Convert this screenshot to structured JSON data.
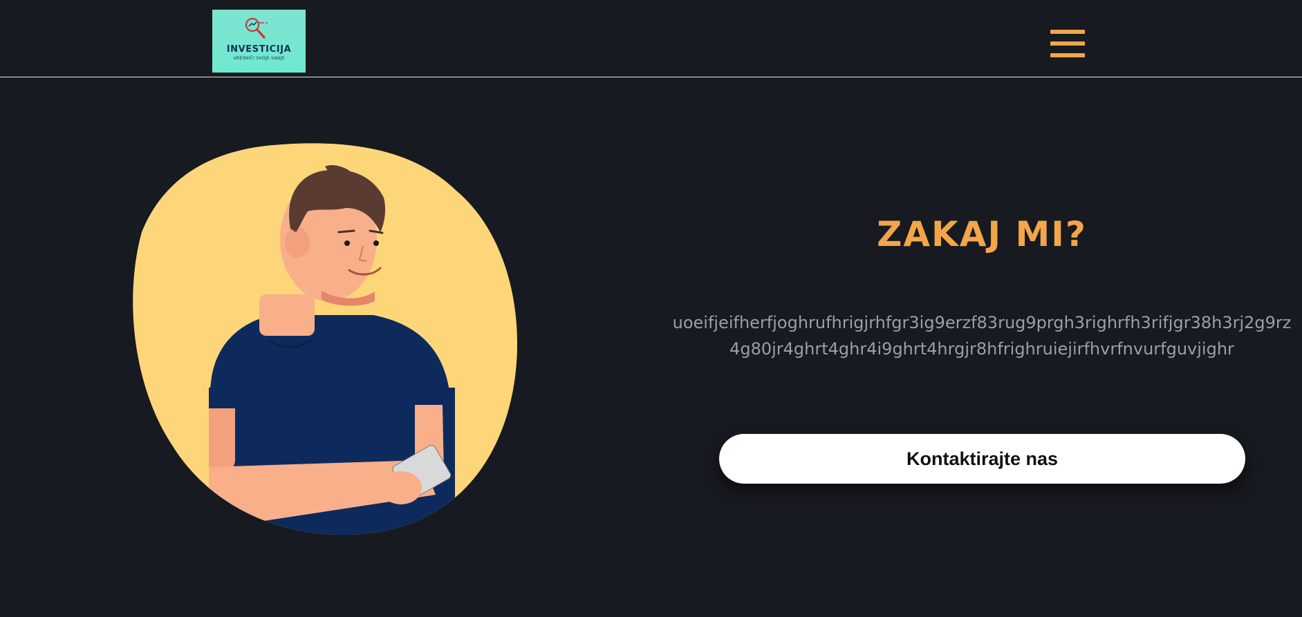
{
  "header": {
    "logo": {
      "title": "INVESTICIJA",
      "subtitle": "URESNIČI SVOJE SANJE",
      "icon": "magnifier-chart-icon",
      "bg_color": "#73e6d0"
    },
    "menu_icon": "hamburger-menu-icon",
    "accent_color": "#f2a649"
  },
  "illustration": {
    "icon": "man-with-card-illustration",
    "circle_color": "#fdd67a",
    "shirt_color": "#0e2a5c"
  },
  "section": {
    "title": "ZAKAJ MI?",
    "text": "uoeifjeifherfjoghrufhrigjrhfgr3ig9erzf83rug9prgh3righrfh3rifjgr38h3rj2g9rz4g80jr4ghrt4ghr4i9ghrt4hrgjr8hfrighruiejirfhvrfnvurfguvjighr",
    "cta_label": "Kontaktirajte nas"
  },
  "colors": {
    "background": "#171a20",
    "title": "#f2a649",
    "text": "#9aa0a6",
    "button_bg": "#ffffff"
  }
}
